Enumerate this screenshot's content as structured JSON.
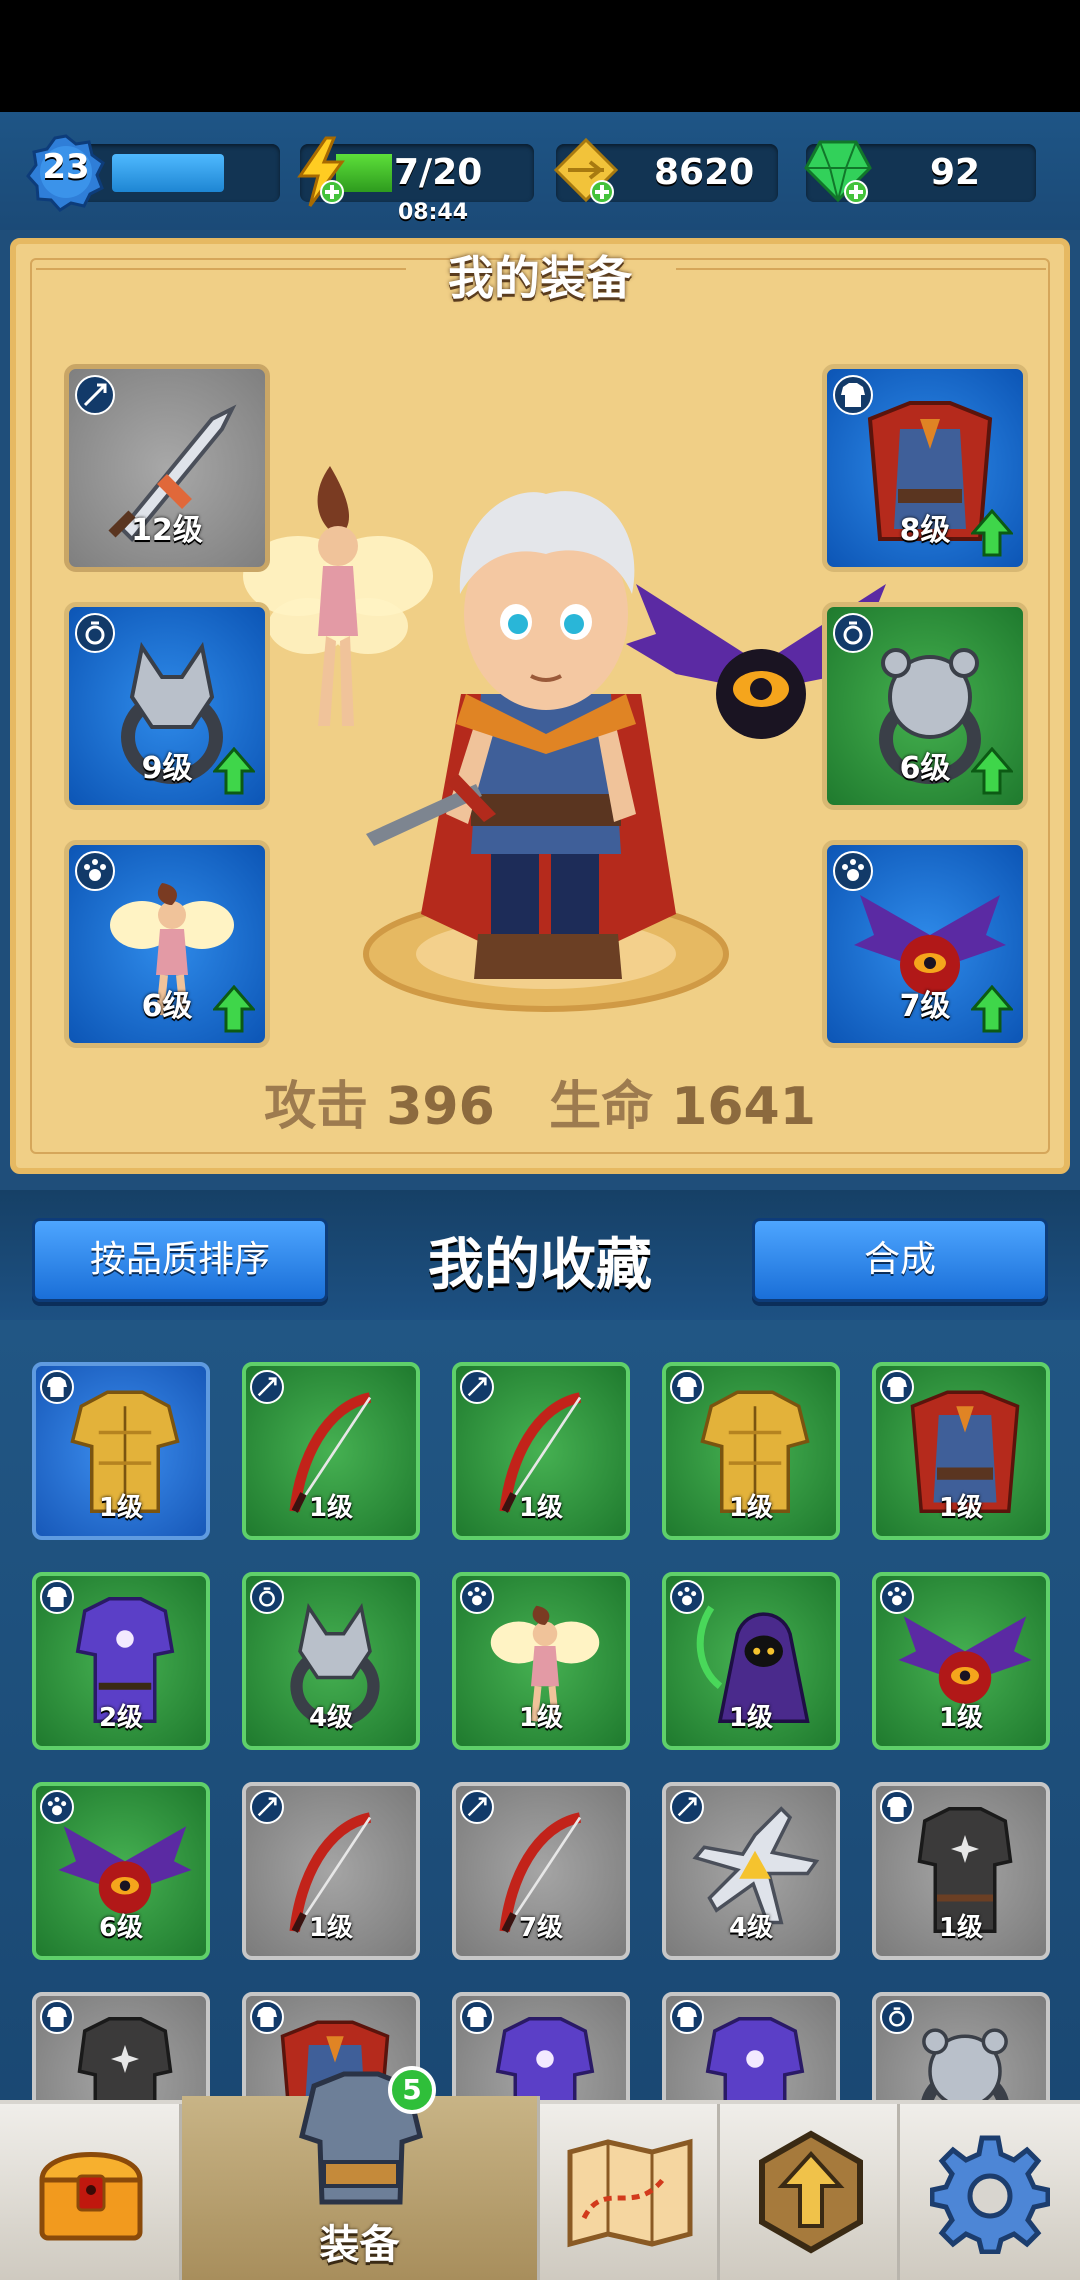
{
  "top_bar": {
    "level": "23",
    "xp_fraction": 0.7,
    "energy": "7/20",
    "energy_fraction": 0.35,
    "energy_timer": "08:44",
    "gold": "8620",
    "gems": "92"
  },
  "equipment": {
    "title": "我的装备",
    "slots": [
      {
        "level": "12级",
        "rarity": "grey",
        "type_icon": "weapon-icon",
        "item": "sword",
        "upgrade": false
      },
      {
        "level": "9级",
        "rarity": "blue",
        "type_icon": "ring-icon",
        "item": "wolf-ring",
        "upgrade": true
      },
      {
        "level": "6级",
        "rarity": "blue",
        "type_icon": "pet-icon",
        "item": "fairy",
        "upgrade": true
      },
      {
        "level": "8级",
        "rarity": "blue",
        "type_icon": "armor-icon",
        "item": "cape-armor",
        "upgrade": true
      },
      {
        "level": "6级",
        "rarity": "green",
        "type_icon": "ring-icon",
        "item": "bear-ring",
        "upgrade": true
      },
      {
        "level": "7级",
        "rarity": "blue",
        "type_icon": "pet-icon",
        "item": "bat",
        "upgrade": true
      }
    ],
    "attack_label": "攻击",
    "attack_value": "396",
    "hp_label": "生命",
    "hp_value": "1641"
  },
  "collection": {
    "sort_button": "按品质排序",
    "title": "我的收藏",
    "merge_button": "合成",
    "items": [
      {
        "level": "1级",
        "rarity": "blue",
        "type_icon": "armor-icon",
        "item": "gold-armor"
      },
      {
        "level": "1级",
        "rarity": "green",
        "type_icon": "weapon-icon",
        "item": "bow"
      },
      {
        "level": "1级",
        "rarity": "green",
        "type_icon": "weapon-icon",
        "item": "bow"
      },
      {
        "level": "1级",
        "rarity": "green",
        "type_icon": "armor-icon",
        "item": "gold-armor"
      },
      {
        "level": "1级",
        "rarity": "green",
        "type_icon": "armor-icon",
        "item": "cape-armor"
      },
      {
        "level": "2级",
        "rarity": "green",
        "type_icon": "armor-icon",
        "item": "purple-robe"
      },
      {
        "level": "4级",
        "rarity": "green",
        "type_icon": "ring-icon",
        "item": "wolf-ring"
      },
      {
        "level": "1级",
        "rarity": "green",
        "type_icon": "pet-icon",
        "item": "fairy"
      },
      {
        "level": "1级",
        "rarity": "green",
        "type_icon": "pet-icon",
        "item": "reaper"
      },
      {
        "level": "1级",
        "rarity": "green",
        "type_icon": "pet-icon",
        "item": "bat"
      },
      {
        "level": "6级",
        "rarity": "green",
        "type_icon": "pet-icon",
        "item": "bat"
      },
      {
        "level": "1级",
        "rarity": "grey",
        "type_icon": "weapon-icon",
        "item": "bow"
      },
      {
        "level": "7级",
        "rarity": "grey",
        "type_icon": "weapon-icon",
        "item": "bow"
      },
      {
        "level": "4级",
        "rarity": "grey",
        "type_icon": "weapon-icon",
        "item": "shuriken"
      },
      {
        "level": "1级",
        "rarity": "grey",
        "type_icon": "armor-icon",
        "item": "dark-vest"
      },
      {
        "level": "",
        "rarity": "grey",
        "type_icon": "armor-icon",
        "item": "dark-vest"
      },
      {
        "level": "",
        "rarity": "grey",
        "type_icon": "armor-icon",
        "item": "cape-armor"
      },
      {
        "level": "",
        "rarity": "grey",
        "type_icon": "armor-icon",
        "item": "purple-robe"
      },
      {
        "level": "",
        "rarity": "grey",
        "type_icon": "armor-icon",
        "item": "purple-robe"
      },
      {
        "level": "",
        "rarity": "grey",
        "type_icon": "ring-icon",
        "item": "bear-ring"
      }
    ]
  },
  "bottom_nav": {
    "items": [
      {
        "id": "chest",
        "icon": "treasure-chest-icon",
        "label": ""
      },
      {
        "id": "equipment",
        "icon": "armor-nav-icon",
        "label": "装备",
        "badge": "5",
        "active": true
      },
      {
        "id": "map",
        "icon": "map-icon",
        "label": ""
      },
      {
        "id": "upgrade",
        "icon": "upgrade-arrow-icon",
        "label": ""
      },
      {
        "id": "settings",
        "icon": "gear-icon",
        "label": ""
      }
    ]
  }
}
